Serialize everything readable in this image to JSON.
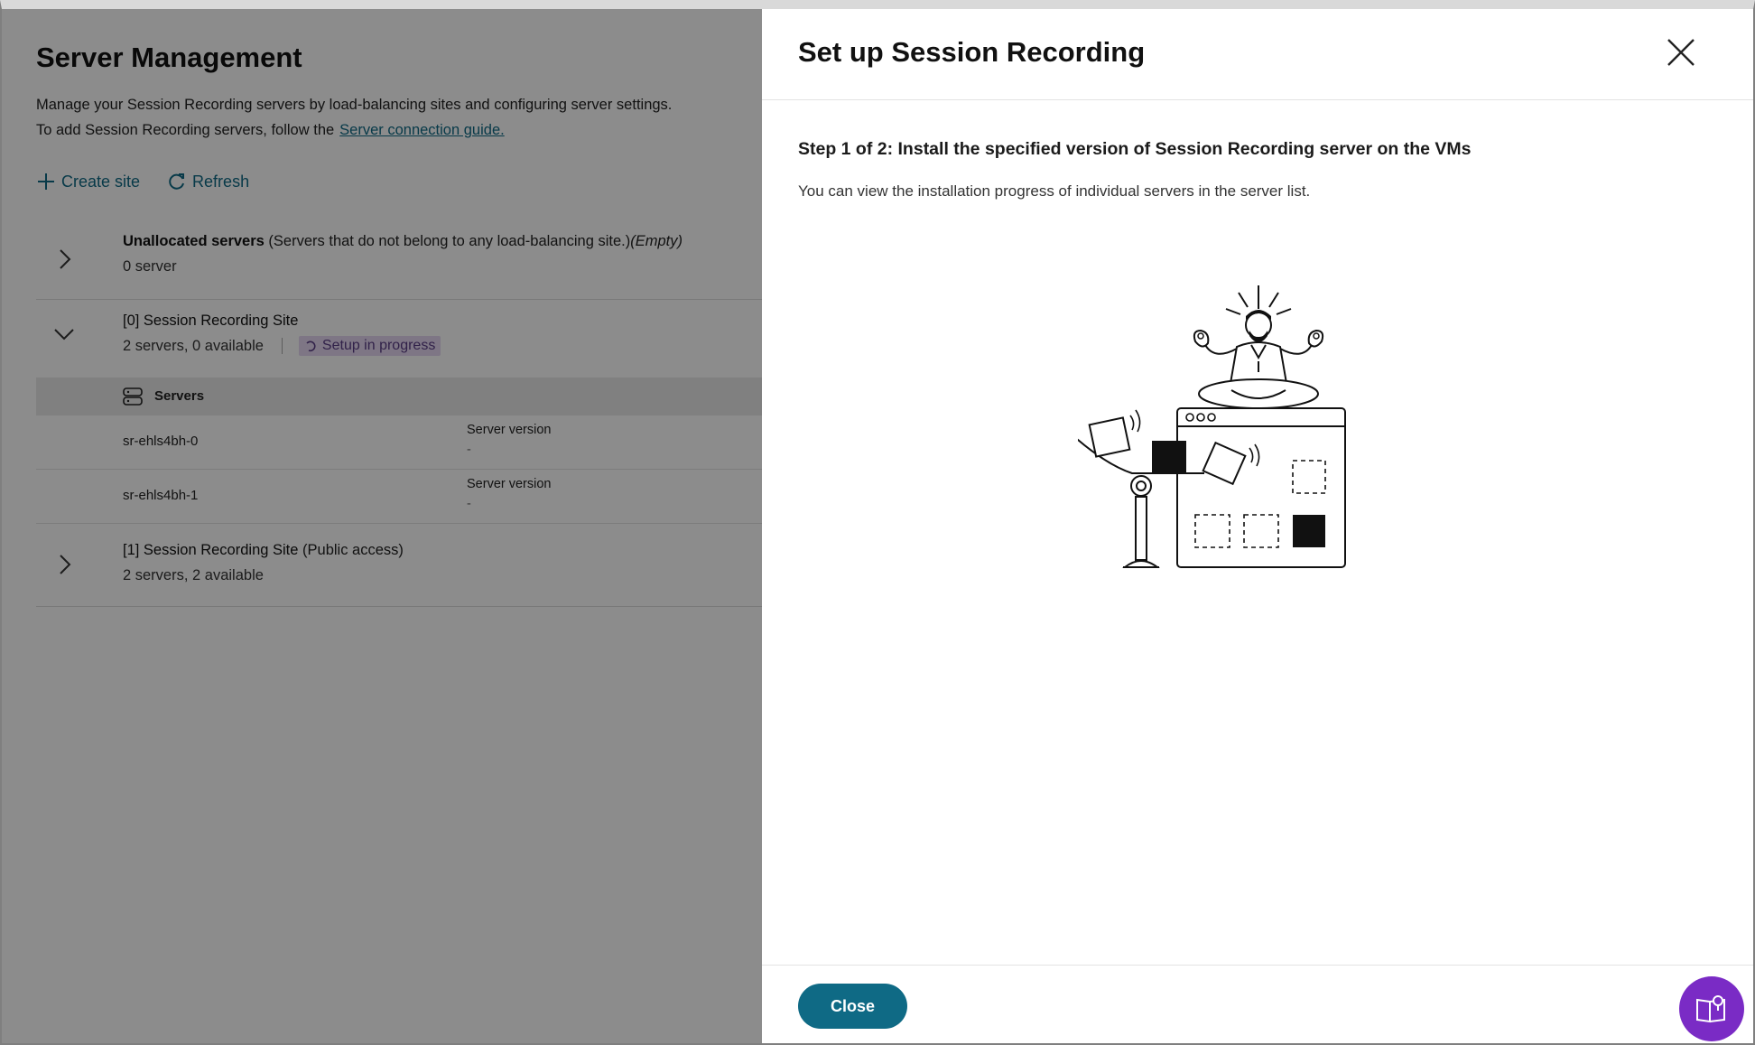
{
  "page": {
    "title": "Server Management",
    "description_line1": "Manage your Session Recording servers by load-balancing sites and configuring server settings.",
    "description_line2": "To add Session Recording servers, follow the",
    "guide_link": "Server connection guide."
  },
  "actions": {
    "create_site": "Create site",
    "refresh": "Refresh"
  },
  "groups": [
    {
      "title": "Unallocated servers",
      "note": " (Servers that do not belong to any load-balancing site.)",
      "empty": "(Empty)",
      "subtitle": "0 server"
    },
    {
      "title": "[0] Session Recording Site",
      "subtitle": "2 servers, 0 available",
      "status": "Setup in progress"
    },
    {
      "title": "[1] Session Recording Site",
      "note": " (Public access)",
      "subtitle": "2 servers, 2 available"
    }
  ],
  "servers": {
    "header": "Servers",
    "rows": [
      {
        "name": "sr-ehls4bh-0",
        "version_label": "Server version",
        "version_value": "-"
      },
      {
        "name": "sr-ehls4bh-1",
        "version_label": "Server version",
        "version_value": "-"
      }
    ]
  },
  "panel": {
    "title": "Set up Session Recording",
    "step_title": "Step 1 of 2: Install the specified version of Session Recording server on the VMs",
    "step_desc": "You can view the installation progress of individual servers in the server list.",
    "close_button": "Close"
  },
  "icons": {
    "create": "plus-icon",
    "refresh": "refresh-icon",
    "close": "close-icon",
    "help": "help-book-icon"
  },
  "colors": {
    "accent": "#0f6a85",
    "status_badge_bg": "#e5d8f2",
    "help_button": "#7a2bc5"
  }
}
